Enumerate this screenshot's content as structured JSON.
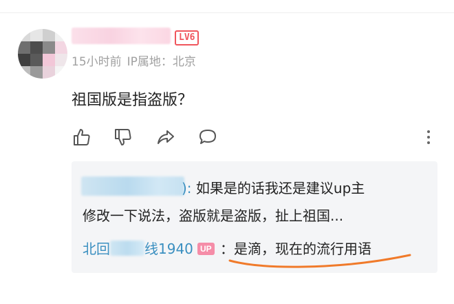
{
  "comment": {
    "user": {
      "avatar_icon": "avatar-mosaic",
      "level_badge": "LV6"
    },
    "meta": {
      "time": "15小时前",
      "ip_label": "IP属地：北京"
    },
    "text": "祖国版是指盗版？",
    "actions": [
      {
        "icon": "thumb-up-icon"
      },
      {
        "icon": "thumb-down-icon"
      },
      {
        "icon": "share-icon"
      },
      {
        "icon": "comment-bubble-icon"
      },
      {
        "icon": "more-vertical-icon"
      }
    ]
  },
  "replies": {
    "reply1": {
      "name_suffix": "):",
      "line1": " 如果是的话我还是建议up主",
      "line2": "修改一下说法，盗版就是盗版，扯上祖国..."
    },
    "reply2": {
      "name_prefix": "北回",
      "name_suffix": "线1940",
      "badge": "UP",
      "colon": "：",
      "text": "是滴，现在的流行用语"
    }
  },
  "colors": {
    "accent_blue": "#3a8fc0",
    "level_red": "#f0555c",
    "up_badge_pink": "#f58da8",
    "annotation_orange": "#f07a2a"
  }
}
